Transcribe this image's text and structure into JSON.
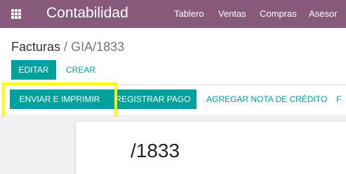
{
  "navbar": {
    "app_title": "Contabilidad",
    "menu": [
      {
        "label": "Tablero"
      },
      {
        "label": "Ventas"
      },
      {
        "label": "Compras"
      },
      {
        "label": "Asesor"
      }
    ],
    "icon": "apps-grid-icon",
    "bg_color": "#875a7b"
  },
  "breadcrumb": {
    "parent": "Facturas",
    "separator": "/",
    "current": "GIA/1833"
  },
  "toolbar": {
    "edit_label": "EDITAR",
    "create_label": "CREAR"
  },
  "statusbar": {
    "send_print_label": "ENVIAR E IMPRIMIR",
    "register_payment_label": "REGISTRAR PAGO",
    "credit_note_label": "AGREGAR NOTA DE CRÉDITO",
    "more_label": "F"
  },
  "form": {
    "invoice_number": "/1833"
  },
  "colors": {
    "accent": "#00a09d",
    "highlight": "#ffff00"
  }
}
